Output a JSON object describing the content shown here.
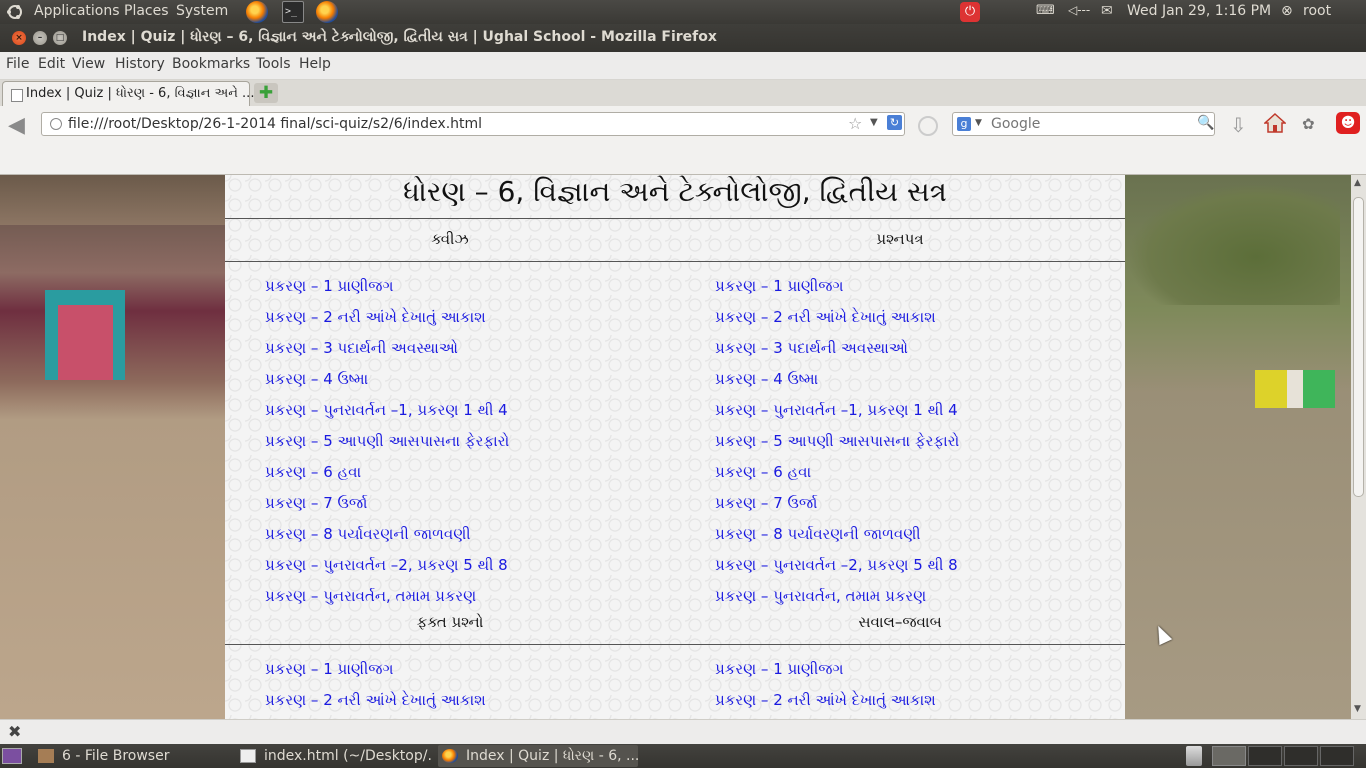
{
  "top_panel": {
    "menus": [
      "Applications",
      "Places",
      "System"
    ],
    "volume_label": "◁---",
    "clock": "Wed Jan 29,  1:16 PM",
    "user": "root"
  },
  "window": {
    "title": "Index | Quiz | ધોરણ – 6, વિજ્ઞાન અને ટેક્નોલોજી, દ્વિતીય સત્ર  | Ughal School - Mozilla Firefox"
  },
  "menubar": [
    "File",
    "Edit",
    "View",
    "History",
    "Bookmarks",
    "Tools",
    "Help"
  ],
  "tab": {
    "label": "Index | Quiz | ધોરણ  - 6, વિજ્ઞાન અને ..."
  },
  "navbar": {
    "url": "file:///root/Desktop/26-1-2014 final/sci-quiz/s2/6/index.html",
    "search_placeholder": "Google"
  },
  "page": {
    "heading": "ધોરણ – 6, વિજ્ઞાન અને ટેક્નોલોજી, દ્વિતીય સત્ર",
    "col1_header": "ક્વીઝ",
    "col2_header": "પ્રશ્નપત્ર",
    "col1_links": [
      "પ્રકરણ – 1 પ્રાણીજગ",
      "પ્રકરણ – 2 નરી આંખે દેખાતું આકાશ",
      "પ્રકરણ – 3 પદાર્થની અવસ્થાઓ",
      "પ્રકરણ – 4 ઉષ્મા",
      "પ્રકરણ – પુનરાવર્તન –1, પ્રકરણ 1 થી 4",
      "પ્રકરણ – 5 આપણી આસપાસના ફેરફારો",
      "પ્રકરણ – 6 હવા",
      "પ્રકરણ – 7 ઉર્જા",
      "પ્રકરણ – 8 પર્યાવરણની જાળવણી",
      "પ્રકરણ – પુનરાવર્તન –2, પ્રકરણ 5 થી 8",
      "પ્રકરણ – પુનરાવર્તન, તમામ પ્રકરણ"
    ],
    "col2_links": [
      "પ્રકરણ – 1 પ્રાણીજગ",
      "પ્રકરણ – 2 નરી આંખે દેખાતું આકાશ",
      "પ્રકરણ – 3 પદાર્થની અવસ્થાઓ",
      "પ્રકરણ – 4 ઉષ્મા",
      "પ્રકરણ – પુનરાવર્તન –1, પ્રકરણ 1 થી 4",
      "પ્રકરણ – 5 આપણી આસપાસના ફેરફારો",
      "પ્રકરણ – 6 હવા",
      "પ્રકરણ – 7 ઉર્જા",
      "પ્રકરણ – 8 પર્યાવરણની જાળવણી",
      "પ્રકરણ – પુનરાવર્તન –2, પ્રકરણ 5 થી 8",
      "પ્રકરણ – પુનરાવર્તન, તમામ પ્રકરણ"
    ],
    "col3_header": "ફક્ત પ્રશ્નો",
    "col4_header": "સવાલ–જવાબ",
    "col3_links": [
      "પ્રકરણ – 1 પ્રાણીજગ",
      "પ્રકરણ – 2 નરી આંખે દેખાતું આકાશ"
    ],
    "col4_links": [
      "પ્રકરણ – 1 પ્રાણીજગ",
      "પ્રકરણ – 2 નરી આંખે દેખાતું આકાશ"
    ]
  },
  "taskbar": {
    "items": [
      "6 - File Browser",
      "index.html (~/Desktop/...",
      "Index | Quiz | ધોરણ  - 6, ..."
    ]
  }
}
